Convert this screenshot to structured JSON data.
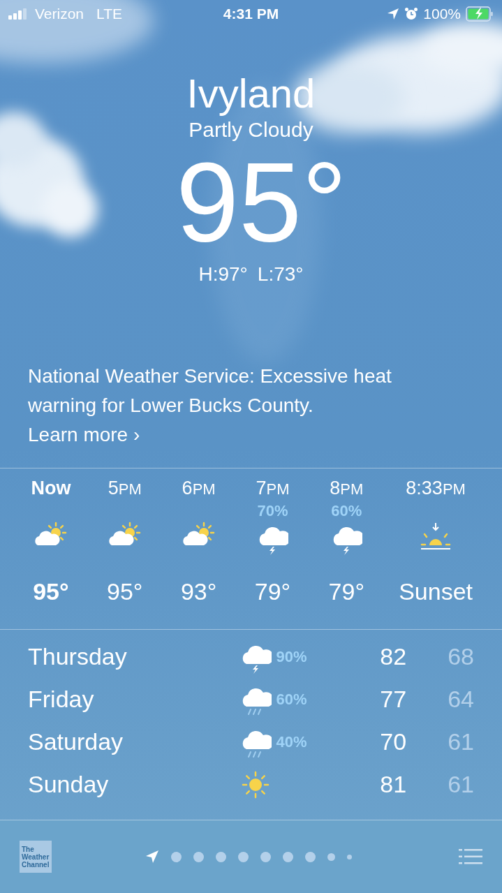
{
  "status_bar": {
    "carrier": "Verizon",
    "network": "LTE",
    "time": "4:31 PM",
    "battery": "100%",
    "charging": true
  },
  "header": {
    "city": "Ivyland",
    "condition": "Partly Cloudy",
    "temperature": "95°",
    "high": "H:97°",
    "low": "L:73°"
  },
  "alert": {
    "text": "National Weather Service: Excessive heat warning for Lower Bucks County.",
    "link": "Learn more",
    "chevron": "›"
  },
  "hourly": [
    {
      "kind": "now",
      "label": "Now",
      "icon": {
        "kind": "partly_sunny"
      },
      "value": "95°"
    },
    {
      "kind": "hour",
      "hour": "5",
      "meridiem": "PM",
      "icon": {
        "kind": "partly_sunny"
      },
      "value": "95°"
    },
    {
      "kind": "hour",
      "hour": "6",
      "meridiem": "PM",
      "icon": {
        "kind": "partly_sunny"
      },
      "value": "93°"
    },
    {
      "kind": "hour",
      "hour": "7",
      "meridiem": "PM",
      "precip": "70%",
      "icon": {
        "kind": "thunderstorm"
      },
      "value": "79°"
    },
    {
      "kind": "hour",
      "hour": "8",
      "meridiem": "PM",
      "precip": "60%",
      "icon": {
        "kind": "thunderstorm"
      },
      "value": "79°"
    },
    {
      "kind": "hour",
      "hour": "8:33",
      "meridiem": "PM",
      "icon": {
        "kind": "sunset"
      },
      "value": "Sunset"
    }
  ],
  "daily": [
    {
      "day": "Thursday",
      "icon": {
        "kind": "thunderstorm"
      },
      "precip": "90%",
      "high": "82",
      "low": "68"
    },
    {
      "day": "Friday",
      "icon": {
        "kind": "rain"
      },
      "precip": "60%",
      "high": "77",
      "low": "64"
    },
    {
      "day": "Saturday",
      "icon": {
        "kind": "rain"
      },
      "precip": "40%",
      "high": "70",
      "low": "61"
    },
    {
      "day": "Sunday",
      "icon": {
        "kind": "sunny"
      },
      "high": "81",
      "low": "61"
    }
  ],
  "bottom_bar": {
    "logo": [
      "The",
      "Weather",
      "Channel"
    ],
    "pages": [
      {
        "kind": "location",
        "selected": true
      },
      {
        "kind": "dot",
        "selected": false
      },
      {
        "kind": "dot",
        "selected": false
      },
      {
        "kind": "dot",
        "selected": false
      },
      {
        "kind": "dot",
        "selected": false
      },
      {
        "kind": "dot",
        "selected": false
      },
      {
        "kind": "dot",
        "selected": false
      },
      {
        "kind": "dot",
        "selected": false
      },
      {
        "kind": "medium",
        "selected": false
      },
      {
        "kind": "small",
        "selected": false
      }
    ]
  }
}
